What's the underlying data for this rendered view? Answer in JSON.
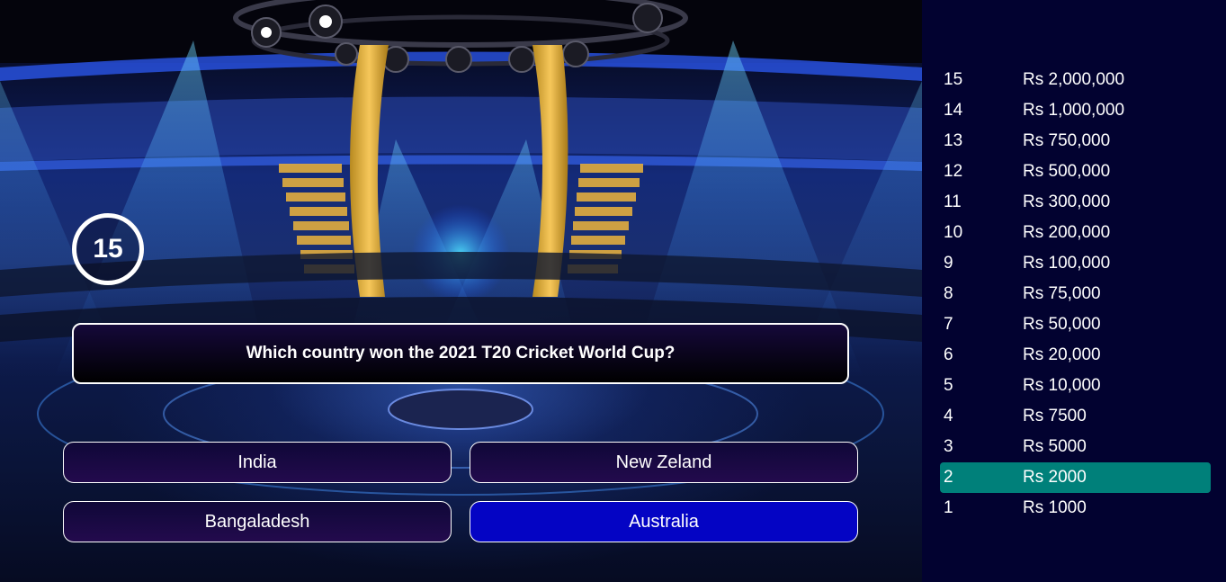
{
  "timer": {
    "value": "15"
  },
  "question": {
    "text": "Which country won the 2021 T20 Cricket World Cup?"
  },
  "answers": [
    {
      "text": "India",
      "selected": false
    },
    {
      "text": "New Zeland",
      "selected": false
    },
    {
      "text": "Bangaladesh",
      "selected": false
    },
    {
      "text": "Australia",
      "selected": true
    }
  ],
  "money_pyramid": [
    {
      "level": "15",
      "amount": "Rs 2,000,000"
    },
    {
      "level": "14",
      "amount": "Rs 1,000,000"
    },
    {
      "level": "13",
      "amount": "Rs 750,000"
    },
    {
      "level": "12",
      "amount": "Rs 500,000"
    },
    {
      "level": "11",
      "amount": "Rs 300,000"
    },
    {
      "level": "10",
      "amount": "Rs 200,000"
    },
    {
      "level": "9",
      "amount": "Rs 100,000"
    },
    {
      "level": "8",
      "amount": "Rs 75,000"
    },
    {
      "level": "7",
      "amount": "Rs 50,000"
    },
    {
      "level": "6",
      "amount": "Rs 20,000"
    },
    {
      "level": "5",
      "amount": "Rs 10,000"
    },
    {
      "level": "4",
      "amount": "Rs 7500"
    },
    {
      "level": "3",
      "amount": "Rs 5000"
    },
    {
      "level": "2",
      "amount": "Rs 2000",
      "active": true
    },
    {
      "level": "1",
      "amount": "Rs 1000"
    }
  ],
  "colors": {
    "sidebar_bg": "#020230",
    "active_level": "#00807a",
    "selected_answer": "#0404c4",
    "answer_bg": "#1a0a45"
  }
}
